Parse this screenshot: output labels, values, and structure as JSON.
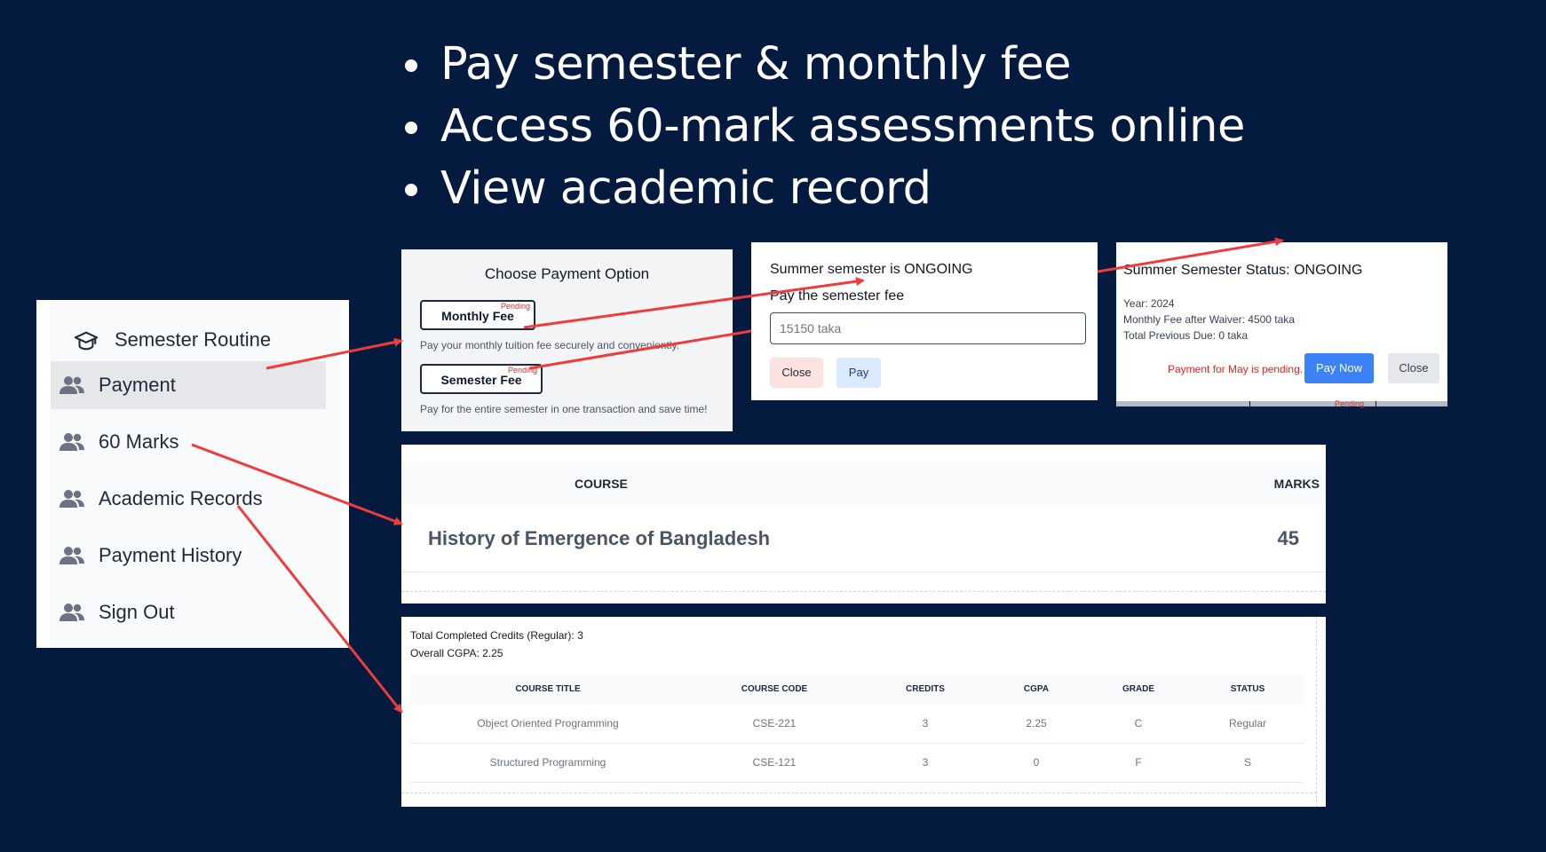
{
  "bullets": [
    "Pay semester & monthly fee",
    "Access 60-mark assessments online",
    "View academic record"
  ],
  "sidebar": {
    "brand": "Semester Routine",
    "items": [
      {
        "label": "Payment"
      },
      {
        "label": "60 Marks"
      },
      {
        "label": "Academic Records"
      },
      {
        "label": "Payment History"
      },
      {
        "label": "Sign Out"
      }
    ]
  },
  "payment_option": {
    "title": "Choose Payment Option",
    "monthly_label": "Monthly Fee",
    "monthly_badge": "Pending",
    "monthly_desc": "Pay your monthly tuition fee securely and conveniently.",
    "semester_label": "Semester Fee",
    "semester_badge": "Pending",
    "semester_desc": "Pay for the entire semester in one transaction and save time!"
  },
  "semester_pay": {
    "heading": "Summer semester is ONGOING",
    "subheading": "Pay the semester fee",
    "input_placeholder": "15150 taka",
    "close_label": "Close",
    "pay_label": "Pay"
  },
  "status_modal": {
    "heading": "Summer Semester Status: ONGOING",
    "year": "Year: 2024",
    "monthly_fee": "Monthly Fee after Waiver: 4500 taka",
    "previous_due": "Total Previous Due: 0 taka",
    "pending_msg": "Payment for May is pending.",
    "pay_now_label": "Pay Now",
    "close_label": "Close",
    "bottom_badge": "Pending"
  },
  "marks_table": {
    "headers": {
      "course": "COURSE",
      "marks": "MARKS"
    },
    "rows": [
      {
        "course": "History of Emergence of Bangladesh",
        "marks": "45"
      }
    ]
  },
  "records": {
    "credits": "Total Completed Credits (Regular): 3",
    "cgpa": "Overall CGPA: 2.25",
    "headers": [
      "COURSE TITLE",
      "COURSE CODE",
      "CREDITS",
      "CGPA",
      "GRADE",
      "STATUS"
    ],
    "rows": [
      [
        "Object Oriented Programming",
        "CSE-221",
        "3",
        "2.25",
        "C",
        "Regular"
      ],
      [
        "Structured Programming",
        "CSE-121",
        "3",
        "0",
        "F",
        "S"
      ]
    ]
  },
  "colors": {
    "background": "#041b3f",
    "arrow": "#ef3b3b",
    "primary_button": "#3b82f6",
    "pending_text": "#dc2626"
  },
  "icons": {
    "brand": "graduation-cap-icon",
    "nav": "users-icon",
    "arrow": "arrow-icon"
  }
}
